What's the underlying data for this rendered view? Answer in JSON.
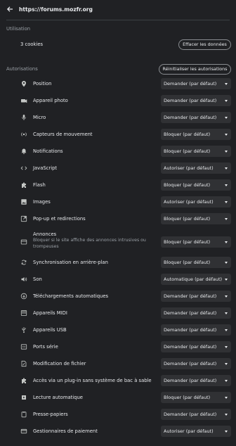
{
  "header": {
    "origin": "https://forums.mozfr.org"
  },
  "usage": {
    "section_title": "Utilisation",
    "cookies_text": "3 cookies",
    "clear_button": "Effacer les données"
  },
  "permissions": {
    "section_title": "Autorisations",
    "reset_button": "Réinitialiser les autorisations",
    "items": [
      {
        "label": "Position",
        "value": "Demander (par défaut)",
        "icon": "location-pin-icon"
      },
      {
        "label": "Appareil photo",
        "value": "Demander (par défaut)",
        "icon": "camera-icon"
      },
      {
        "label": "Micro",
        "value": "Demander (par défaut)",
        "icon": "microphone-icon"
      },
      {
        "label": "Capteurs de mouvement",
        "value": "Bloquer (par défaut)",
        "icon": "motion-sensor-icon"
      },
      {
        "label": "Notifications",
        "value": "Bloquer (par défaut)",
        "icon": "bell-icon"
      },
      {
        "label": "JavaScript",
        "value": "Autoriser (par défaut)",
        "icon": "code-icon"
      },
      {
        "label": "Flash",
        "value": "Bloquer (par défaut)",
        "icon": "puzzle-icon"
      },
      {
        "label": "Images",
        "value": "Autoriser (par défaut)",
        "icon": "image-icon"
      },
      {
        "label": "Pop-up et redirections",
        "value": "Bloquer (par défaut)",
        "icon": "popup-icon"
      },
      {
        "label": "Annonces",
        "description": "Bloquer si le site affiche des annonces intrusives ou trompeuses",
        "value": "Bloquer (par défaut)",
        "icon": "ads-icon"
      },
      {
        "label": "Synchronisation en arrière-plan",
        "value": "Bloquer (par défaut)",
        "icon": "sync-icon"
      },
      {
        "label": "Son",
        "value": "Automatique (par défaut)",
        "icon": "speaker-icon"
      },
      {
        "label": "Téléchargements automatiques",
        "value": "Demander (par défaut)",
        "icon": "download-icon"
      },
      {
        "label": "Appareils MIDI",
        "value": "Demander (par défaut)",
        "icon": "midi-icon"
      },
      {
        "label": "Appareils USB",
        "value": "Demander (par défaut)",
        "icon": "usb-icon"
      },
      {
        "label": "Ports série",
        "value": "Demander (par défaut)",
        "icon": "serial-port-icon"
      },
      {
        "label": "Modification de fichier",
        "value": "Demander (par défaut)",
        "icon": "file-edit-icon"
      },
      {
        "label": "Accès via un plug-in sans système de bac à sable",
        "value": "Demander (par défaut)",
        "icon": "plugin-icon"
      },
      {
        "label": "Lecture automatique",
        "value": "Bloquer (par défaut)",
        "icon": "autoplay-icon"
      },
      {
        "label": "Presse-papiers",
        "value": "Demander (par défaut)",
        "icon": "clipboard-icon"
      },
      {
        "label": "Gestionnaires de paiement",
        "value": "Autoriser (par défaut)",
        "icon": "payment-card-icon"
      }
    ]
  }
}
